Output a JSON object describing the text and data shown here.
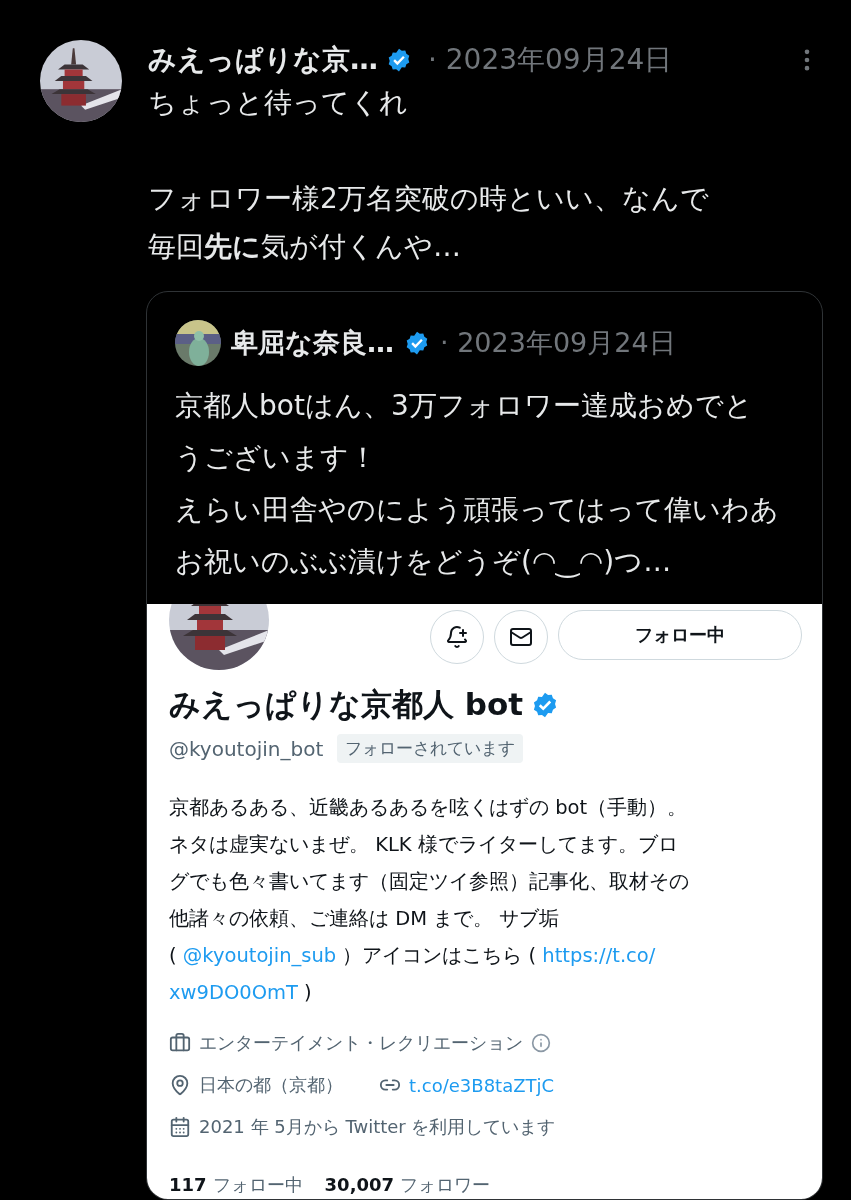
{
  "tweet": {
    "author": "みえっぱりな京…",
    "verified": true,
    "date": "· 2023年09月24日",
    "paragraphs": [
      "ちょっと待ってくれ",
      "フォロワー様2万名突破の時といい、なんで毎回**先に**気が付くんや…"
    ],
    "quote": {
      "author": "卑屈な奈良…",
      "verified": true,
      "date": "· 2023年09月24日",
      "lines": [
        "京都人botはん、3万フォロワー達成おめでとうございます！",
        "えらい田舎やのによう頑張ってはって偉いわあ",
        "お祝いのぶぶ漬けをどうぞ(◠‿◠)つ…"
      ],
      "image": {
        "follow_button": "フォロー中",
        "name": "みえっぱりな京都人 bot",
        "verified": true,
        "handle": "@kyoutojin_bot",
        "follows_you": "フォローされています",
        "bio_lines": [
          [
            {
              "kind": "text",
              "text": "京都あるある、近畿あるあるを呟くはずの bot（手動）。"
            }
          ],
          [
            {
              "kind": "text",
              "text": "ネタは虚実ないまぜ。 KLK 様でライターしてます。ブロ"
            }
          ],
          [
            {
              "kind": "text",
              "text": "グでも色々書いてます（固定ツイ参照）記事化、取材その"
            }
          ],
          [
            {
              "kind": "text",
              "text": "他諸々の依頼、ご連絡は DM まで。 サブ垢"
            }
          ],
          [
            {
              "kind": "text",
              "text": "( "
            },
            {
              "kind": "link",
              "text": "@kyoutojin_sub"
            },
            {
              "kind": "text",
              "text": " ）アイコンはこちら ( "
            },
            {
              "kind": "link",
              "text": "https://t.co/"
            }
          ],
          [
            {
              "kind": "link",
              "text": "xw9DO0OmT"
            },
            {
              "kind": "text",
              "text": " )"
            }
          ]
        ],
        "category": "エンターテイメント・レクリエーション",
        "location": "日本の都（京都）",
        "url": "t.co/e3B8taZTjC",
        "joined": "2021 年 5月から Twitter を利用しています",
        "following_count": "117",
        "following_label": "フォロー中",
        "followers_count": "30,007",
        "followers_label": "フォロワー"
      }
    }
  }
}
